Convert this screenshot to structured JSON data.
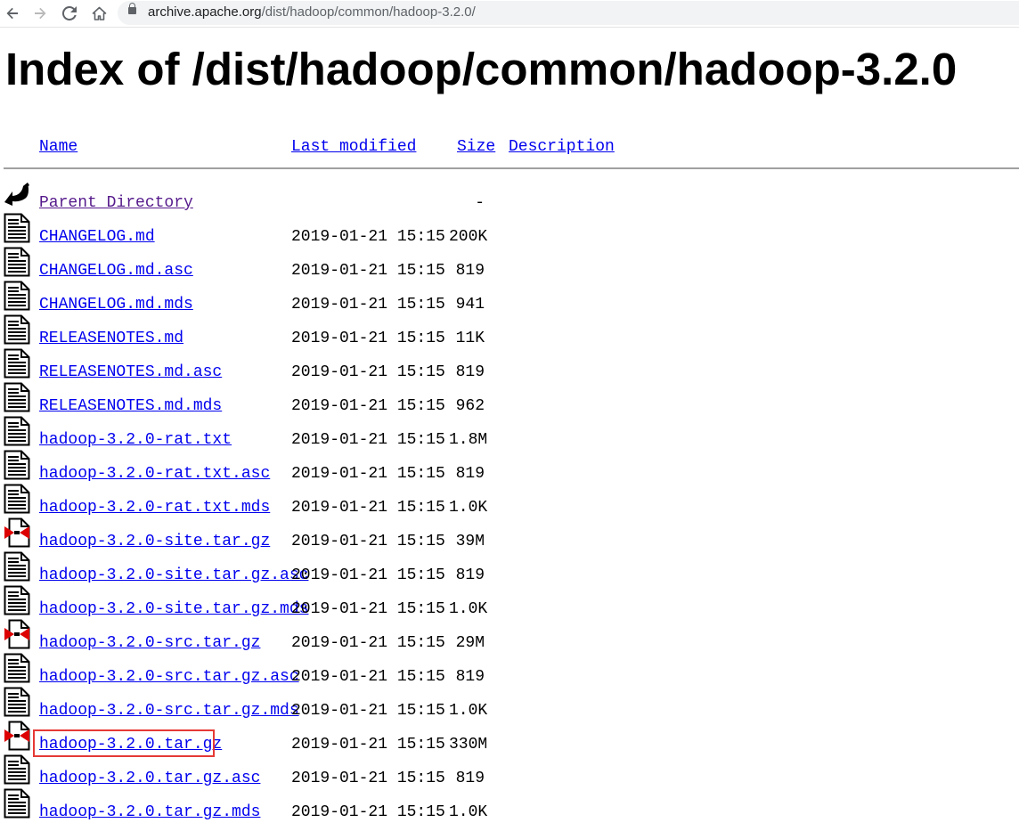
{
  "browser": {
    "url_host": "archive.apache.org",
    "url_path": "/dist/hadoop/common/hadoop-3.2.0/"
  },
  "page": {
    "title": "Index of /dist/hadoop/common/hadoop-3.2.0"
  },
  "table": {
    "headers": {
      "name": "Name",
      "last_modified": "Last modified",
      "size": "Size",
      "description": "Description"
    },
    "rows": [
      {
        "icon": "back-icon",
        "name": "Parent Directory",
        "date": "",
        "size": "-"
      },
      {
        "icon": "text-file-icon",
        "name": "CHANGELOG.md",
        "date": "2019-01-21 15:15",
        "size": "200K"
      },
      {
        "icon": "text-file-icon",
        "name": "CHANGELOG.md.asc",
        "date": "2019-01-21 15:15",
        "size": "819"
      },
      {
        "icon": "text-file-icon",
        "name": "CHANGELOG.md.mds",
        "date": "2019-01-21 15:15",
        "size": "941"
      },
      {
        "icon": "text-file-icon",
        "name": "RELEASENOTES.md",
        "date": "2019-01-21 15:15",
        "size": "11K"
      },
      {
        "icon": "text-file-icon",
        "name": "RELEASENOTES.md.asc",
        "date": "2019-01-21 15:15",
        "size": "819"
      },
      {
        "icon": "text-file-icon",
        "name": "RELEASENOTES.md.mds",
        "date": "2019-01-21 15:15",
        "size": "962"
      },
      {
        "icon": "text-file-icon",
        "name": "hadoop-3.2.0-rat.txt",
        "date": "2019-01-21 15:15",
        "size": "1.8M"
      },
      {
        "icon": "text-file-icon",
        "name": "hadoop-3.2.0-rat.txt.asc",
        "date": "2019-01-21 15:15",
        "size": "819"
      },
      {
        "icon": "text-file-icon",
        "name": "hadoop-3.2.0-rat.txt.mds",
        "date": "2019-01-21 15:15",
        "size": "1.0K"
      },
      {
        "icon": "archive-file-icon",
        "name": "hadoop-3.2.0-site.tar.gz",
        "date": "2019-01-21 15:15",
        "size": "39M"
      },
      {
        "icon": "text-file-icon",
        "name": "hadoop-3.2.0-site.tar.gz.asc",
        "date": "2019-01-21 15:15",
        "size": "819"
      },
      {
        "icon": "text-file-icon",
        "name": "hadoop-3.2.0-site.tar.gz.mds",
        "date": "2019-01-21 15:15",
        "size": "1.0K"
      },
      {
        "icon": "archive-file-icon",
        "name": "hadoop-3.2.0-src.tar.gz",
        "date": "2019-01-21 15:15",
        "size": "29M"
      },
      {
        "icon": "text-file-icon",
        "name": "hadoop-3.2.0-src.tar.gz.asc",
        "date": "2019-01-21 15:15",
        "size": "819"
      },
      {
        "icon": "text-file-icon",
        "name": "hadoop-3.2.0-src.tar.gz.mds",
        "date": "2019-01-21 15:15",
        "size": "1.0K"
      },
      {
        "icon": "archive-file-icon",
        "name": "hadoop-3.2.0.tar.gz",
        "date": "2019-01-21 15:15",
        "size": "330M",
        "highlighted": true
      },
      {
        "icon": "text-file-icon",
        "name": "hadoop-3.2.0.tar.gz.asc",
        "date": "2019-01-21 15:15",
        "size": "819"
      },
      {
        "icon": "text-file-icon",
        "name": "hadoop-3.2.0.tar.gz.mds",
        "date": "2019-01-21 15:15",
        "size": "1.0K"
      }
    ]
  },
  "colors": {
    "link": "#0000ee",
    "visited": "#551a8b",
    "highlight": "#e53935"
  }
}
